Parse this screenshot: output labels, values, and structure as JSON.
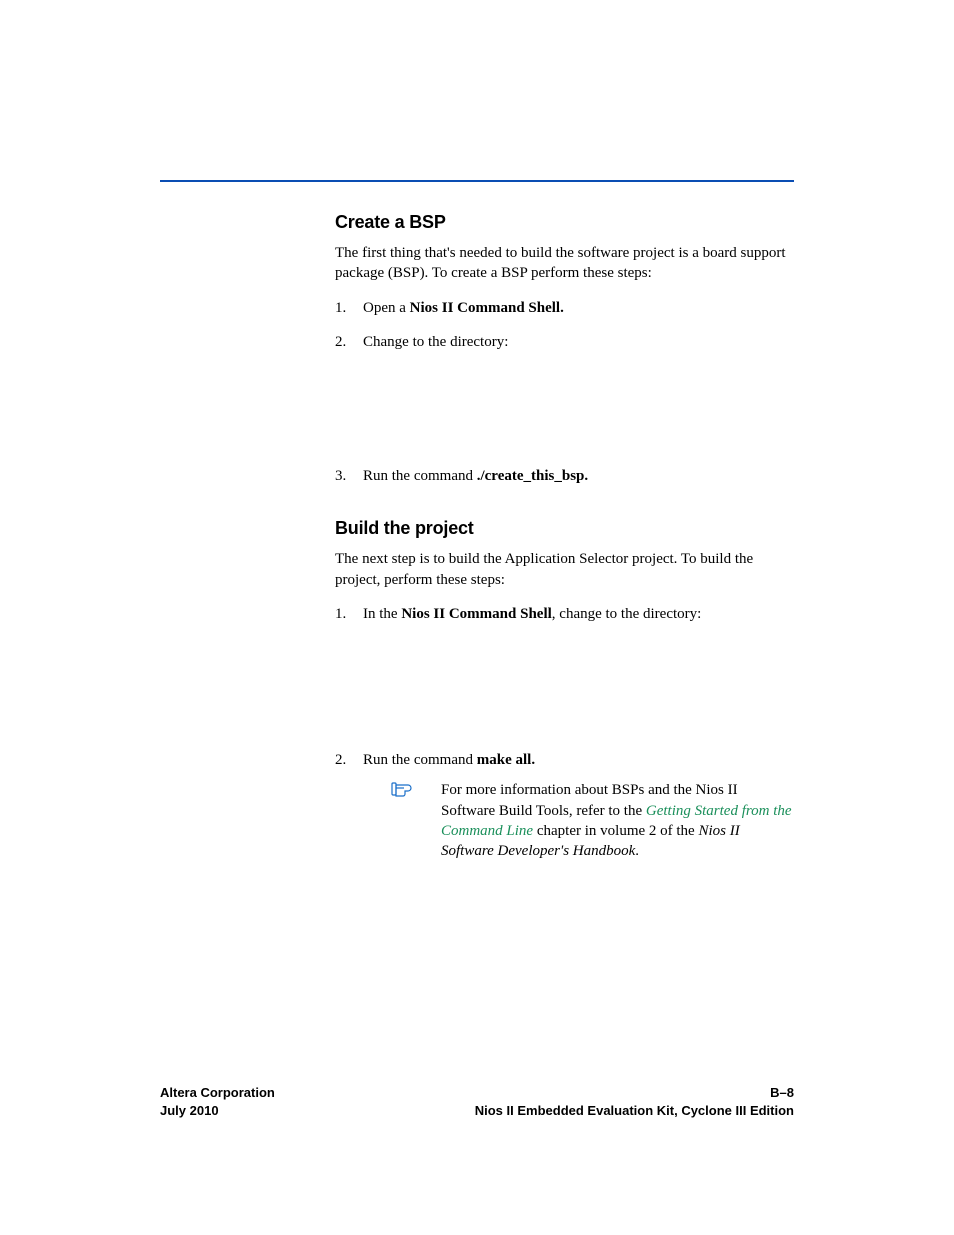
{
  "section1": {
    "heading": "Create a BSP",
    "intro": "The first thing that's needed to build the software project is a board support package (BSP). To create a BSP perform these steps:",
    "steps": {
      "s1_pre": "Open a ",
      "s1_bold": "Nios II Command Shell.",
      "s2": "Change to the directory:",
      "s3_pre": "Run the command ",
      "s3_bold": "./create_this_bsp."
    }
  },
  "section2": {
    "heading": "Build the project",
    "intro": "The next step is to build the Application Selector project. To build the project, perform these steps:",
    "steps": {
      "s1_pre": "In the ",
      "s1_bold": "Nios II Command Shell",
      "s1_post": ", change to the directory:",
      "s2_pre": "Run the command ",
      "s2_bold": "make all."
    },
    "note": {
      "t1": "For more information about BSPs and the Nios II Software Build Tools, refer to the ",
      "link": "Getting Started from the Command Line",
      "t2": " chapter in volume 2 of the ",
      "doc": "Nios II Software Developer's Handbook",
      "t3": "."
    }
  },
  "footer": {
    "left1": "Altera Corporation",
    "left2": "July 2010",
    "right1": "B–8",
    "right2": "Nios II Embedded Evaluation Kit, Cyclone III Edition"
  }
}
